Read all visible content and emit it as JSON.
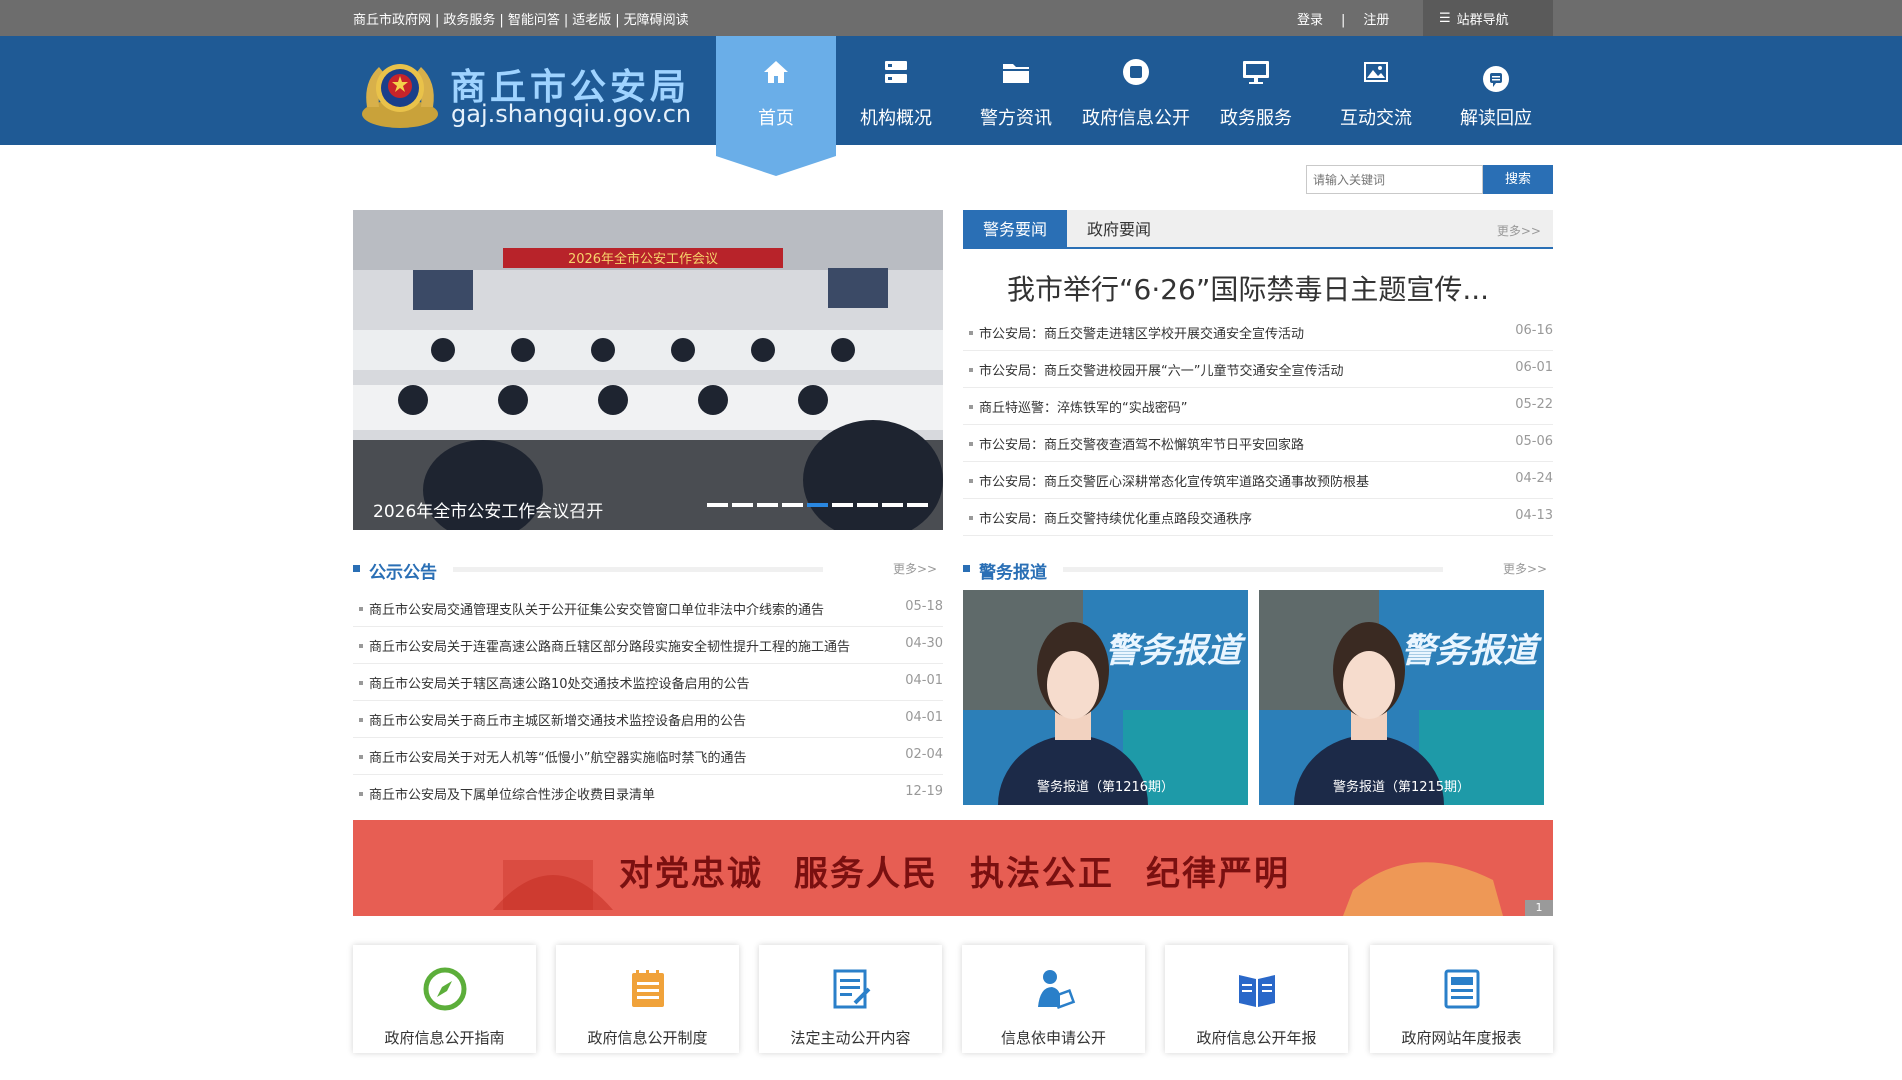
{
  "topbar": {
    "links": [
      "商丘市政府网",
      "政务服务",
      "智能问答",
      "适老版",
      "无障碍阅读"
    ],
    "login": "登录",
    "register": "注册",
    "site_nav": "站群导航"
  },
  "header": {
    "title_cn": "商丘市公安局",
    "title_en": "gaj.shangqiu.gov.cn",
    "nav": [
      {
        "label": "首页",
        "icon": "home-icon"
      },
      {
        "label": "机构概况",
        "icon": "org-icon"
      },
      {
        "label": "警方资讯",
        "icon": "folder-icon"
      },
      {
        "label": "政府信息公开",
        "icon": "info-icon"
      },
      {
        "label": "政务服务",
        "icon": "monitor-icon"
      },
      {
        "label": "互动交流",
        "icon": "image-icon"
      },
      {
        "label": "解读回应",
        "icon": "chat-icon"
      }
    ]
  },
  "search": {
    "placeholder": "请输入关键词",
    "button": "搜索"
  },
  "carousel": {
    "caption": "2026年全市公安工作会议召开",
    "banner_text": "2026年全市公安工作会议",
    "slides": 9,
    "active_slide": 5
  },
  "news": {
    "tabs": [
      "警务要闻",
      "政府要闻"
    ],
    "more": "更多>>",
    "headline": "我市举行“6·26”国际禁毒日主题宣传...",
    "items": [
      {
        "title": "市公安局：商丘交警走进辖区学校开展交通安全宣传活动",
        "date": "06-16"
      },
      {
        "title": "市公安局：商丘交警进校园开展“六一”儿童节交通安全宣传活动",
        "date": "06-01"
      },
      {
        "title": "商丘特巡警：淬炼铁军的“实战密码”",
        "date": "05-22"
      },
      {
        "title": "市公安局：商丘交警夜查酒驾不松懈筑牢节日平安回家路",
        "date": "05-06"
      },
      {
        "title": "市公安局：商丘交警匠心深耕常态化宣传筑牢道路交通事故预防根基",
        "date": "04-24"
      },
      {
        "title": "市公安局：商丘交警持续优化重点路段交通秩序",
        "date": "04-13"
      }
    ]
  },
  "notices": {
    "title": "公示公告",
    "more": "更多>>",
    "items": [
      {
        "title": "商丘市公安局交通管理支队关于公开征集公安交管窗口单位非法中介线索的通告",
        "date": "05-18"
      },
      {
        "title": "商丘市公安局关于连霍高速公路商丘辖区部分路段实施安全韧性提升工程的施工通告",
        "date": "04-30"
      },
      {
        "title": "商丘市公安局关于辖区高速公路10处交通技术监控设备启用的公告",
        "date": "04-01"
      },
      {
        "title": "商丘市公安局关于商丘市主城区新增交通技术监控设备启用的公告",
        "date": "04-01"
      },
      {
        "title": "商丘市公安局关于对无人机等“低慢小”航空器实施临时禁飞的通告",
        "date": "02-04"
      },
      {
        "title": "商丘市公安局及下属单位综合性涉企收费目录清单",
        "date": "12-19"
      }
    ]
  },
  "reports": {
    "title": "警务报道",
    "more": "更多>>",
    "overlay": "警务报道",
    "items": [
      {
        "caption": "警务报道（第1216期）"
      },
      {
        "caption": "警务报道（第1215期）"
      }
    ]
  },
  "banner": {
    "words": [
      "对党忠诚",
      "服务人民",
      "执法公正",
      "纪律严明"
    ],
    "page": "1"
  },
  "cards": [
    {
      "label": "政府信息公开指南",
      "icon": "compass-icon",
      "color": "#5cae3a"
    },
    {
      "label": "政府信息公开制度",
      "icon": "notepad-icon",
      "color": "#f0a23a"
    },
    {
      "label": "法定主动公开内容",
      "icon": "document-list-icon",
      "color": "#2a7fc9"
    },
    {
      "label": "信息依申请公开",
      "icon": "person-apply-icon",
      "color": "#2a7fc9"
    },
    {
      "label": "政府信息公开年报",
      "icon": "book-icon",
      "color": "#2a68c9"
    },
    {
      "label": "政府网站年度报表",
      "icon": "report-icon",
      "color": "#2a7fc9"
    }
  ],
  "colors": {
    "topbar": "#6d6d6d",
    "header": "#1f5a95",
    "nav_active": "#6aaee8",
    "accent": "#2a6fb5",
    "banner": "#e43b2b"
  }
}
